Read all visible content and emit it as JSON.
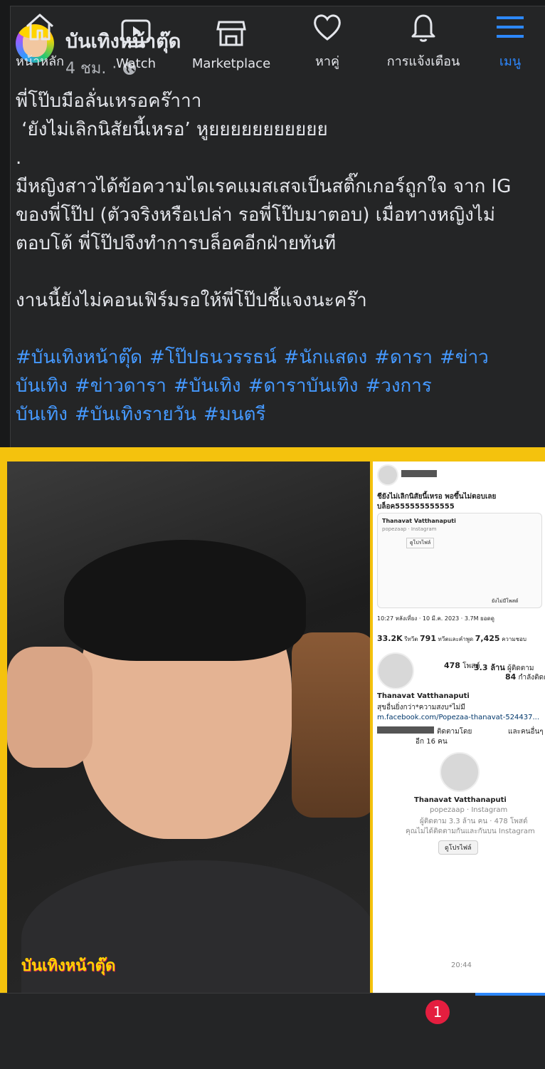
{
  "post": {
    "page_name": "บันเทิงหน้าตุ๊ด",
    "time": "4 ชม.",
    "separator": "·",
    "privacy_icon": "globe-icon",
    "body_lines": [
      "พี่โป๊บมือลั่นเหรอคร๊าาา",
      " ‘ยังไม่เลิกนิสัยนี้เหรอ’ หูยยยยยยยยยยย",
      ".",
      "มีหญิงสาวได้ข้อความไดเรคแมสเสจเป็นสติ๊กเกอร์ถูกใจ จาก IG ของพี่โป๊ป (ตัวจริงหรือเปล่า รอพี่โป๊บมาตอบ) เมื่อทางหญิงไม่ตอบโต้ พี่โป๊ปจึงทำการบล็อคอีกฝ่ายทันที",
      "",
      "งานนี้ยังไม่คอนเฟิร์มรอให้พี่โป๊ปชี้แจงนะคร๊า"
    ],
    "hashtags": [
      "#บันเทิงหน้าตุ๊ด",
      "#โป๊ปธนวรรธน์",
      "#นักแสดง",
      "#ดารา",
      "#ข่าวบันเทิง",
      "#ข่าวดารา",
      "#บันเทิง",
      "#ดาราบันเทิง",
      "#วงการบันเทิง",
      "#บันเทิงรายวัน",
      "#มนตรี"
    ]
  },
  "image": {
    "watermark": "บันเทิงหน้าตุ๊ด",
    "frame_color": "#f4c20d",
    "screenshot": {
      "tweet_text_1": "ชียังไม่เลิกนิสัยนี้เหรอ พอขึ้นไม่ตอบเลย",
      "tweet_text_2": "บล็อค555555555555",
      "card_name": "Thanavat Vatthanaputi",
      "card_handle": "popezaap · Instagram",
      "card_button": "ดูโปรไฟล์",
      "card_status": "ยังไม่มีโพสต์",
      "tweet_meta": "10:27 หลังเที่ยง · 10 มี.ค. 2023 · 3.7M ยอดดู",
      "retweets": "33.2K",
      "retweets_label": "รีทวีต",
      "quotes": "791",
      "quotes_label": "ทวีตและคำพูด",
      "likes": "7,425",
      "likes_label": "ความชอบ",
      "posts_num": "478",
      "posts_label": "โพสต์",
      "followers_num": "3.3 ล้าน",
      "followers_label": "ผู้ติดตาม",
      "following_num": "84",
      "following_label": "กำลังติดตาม",
      "profile_name": "Thanavat Vatthanaputi",
      "profile_bio": "สุขอื่นยิ่งกว่า*ความสงบ*ไม่มี",
      "profile_link": "m.facebook.com/Popezaa-thanavat-524437...",
      "followed_by": "ติดตามโดย",
      "followed_by_more": "และคนอื่นๆ",
      "followed_count": "อีก 16 คน",
      "dm_name": "Thanavat Vatthanaputi",
      "dm_handle": "popezaap · Instagram",
      "dm_stats": "ผู้ติดตาม 3.3 ล้าน คน · 478 โพสต์",
      "dm_note": "คุณไม่ได้ติดตามกันและกันบน Instagram",
      "dm_button": "ดูโปรไฟล์",
      "dm_time": "20:44"
    }
  },
  "nav": {
    "items": [
      {
        "label": "หน้าหลัก",
        "icon": "home-icon"
      },
      {
        "label": "Watch",
        "icon": "watch-icon"
      },
      {
        "label": "Marketplace",
        "icon": "marketplace-icon"
      },
      {
        "label": "หาคู่",
        "icon": "dating-heart-icon"
      },
      {
        "label": "การแจ้งเตือน",
        "icon": "bell-icon"
      },
      {
        "label": "เมนู",
        "icon": "menu-icon"
      }
    ],
    "notification_count": "1",
    "active_color": "#2d88ff",
    "badge_color": "#e41e3f",
    "hashtag_color": "#4599ff"
  }
}
